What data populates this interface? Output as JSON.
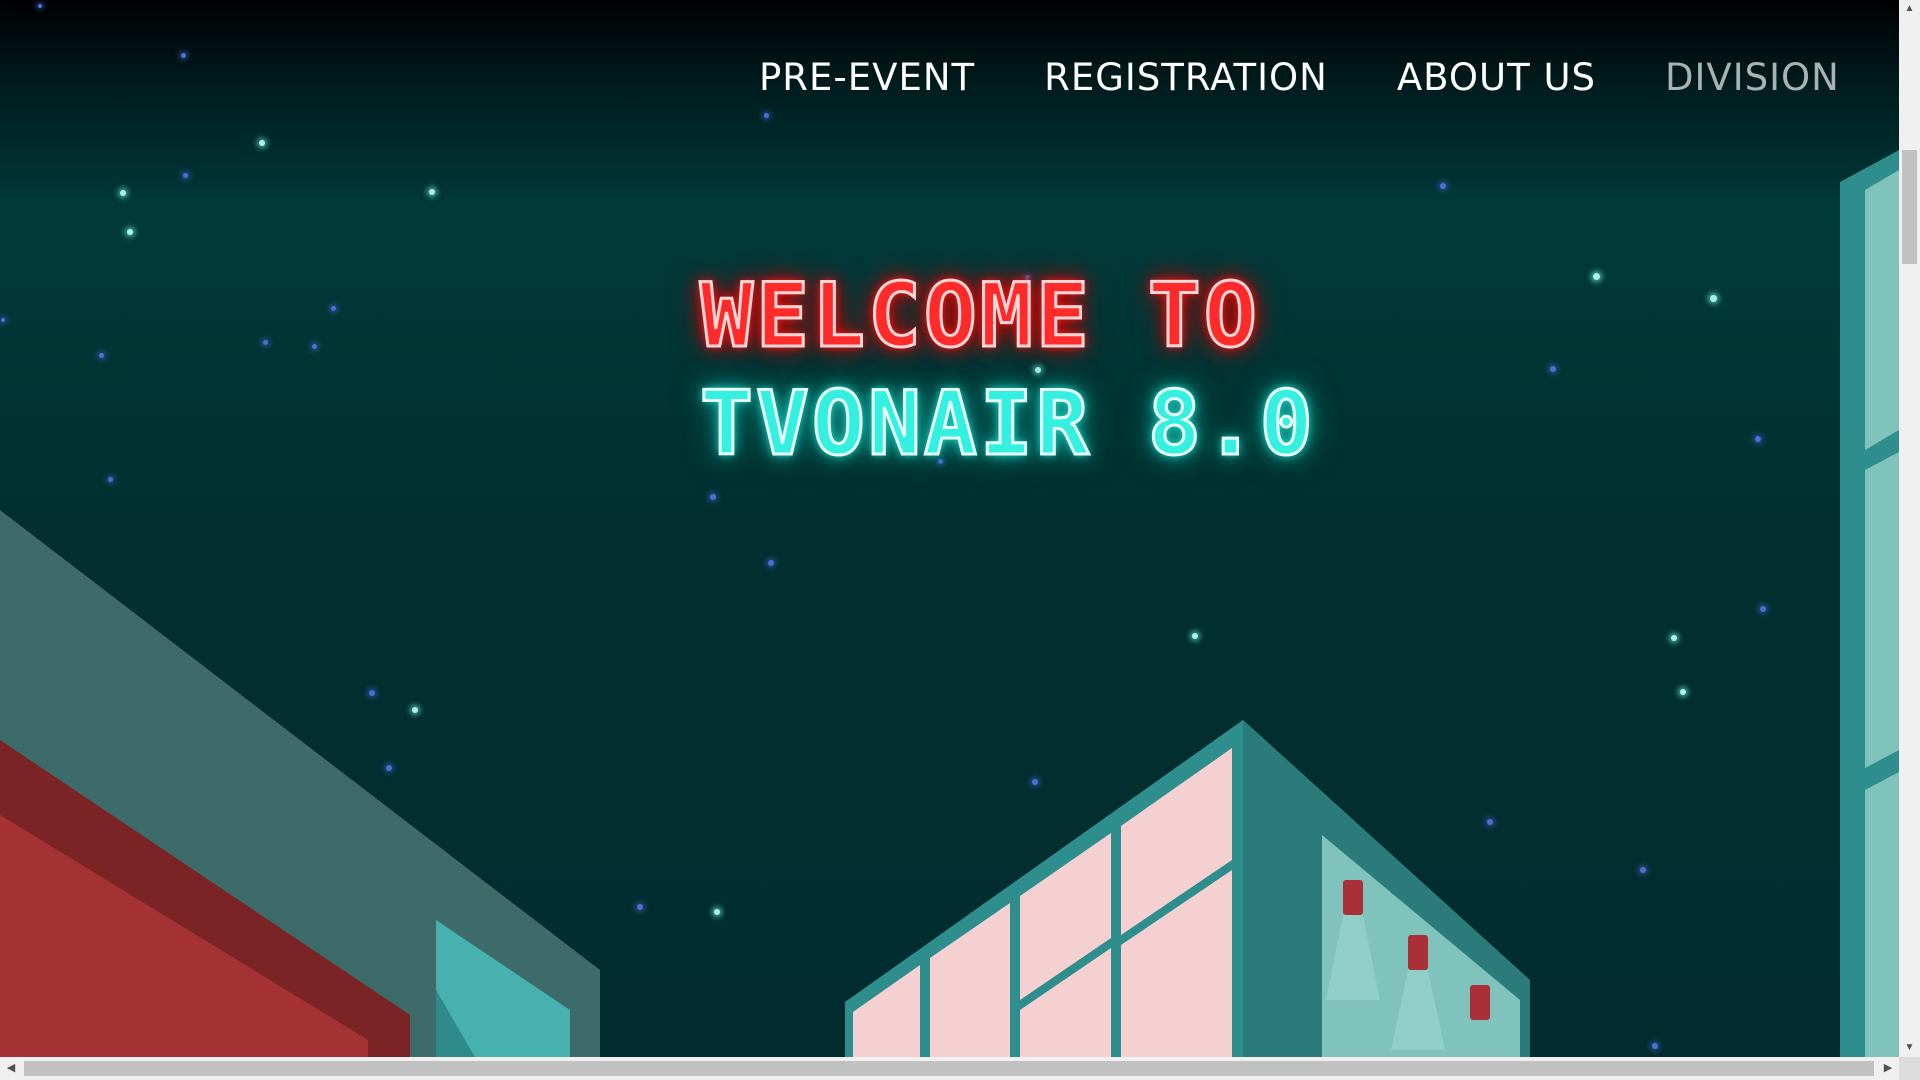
{
  "nav": {
    "items": [
      {
        "label": "PRE-EVENT",
        "active": false
      },
      {
        "label": "REGISTRATION",
        "active": false
      },
      {
        "label": "ABOUT US",
        "active": false
      },
      {
        "label": "DIVISION",
        "active": true
      }
    ]
  },
  "hero": {
    "line1": "WELCOME TO",
    "line2": "TVONAIR 8.0"
  },
  "colors": {
    "sky_top": "#000000",
    "sky_mid": "#013a3a",
    "neon_red": "#ff2b2b",
    "neon_cyan": "#33f0e0",
    "building_teal": "#3a9a9a",
    "building_red": "#a53234",
    "window_pink": "#f5d0d0",
    "nav_active": "#a8b3b4"
  },
  "icons": {
    "scroll_up": "triangle-up",
    "scroll_down": "triangle-down",
    "scroll_left": "triangle-left",
    "scroll_right": "triangle-right"
  }
}
